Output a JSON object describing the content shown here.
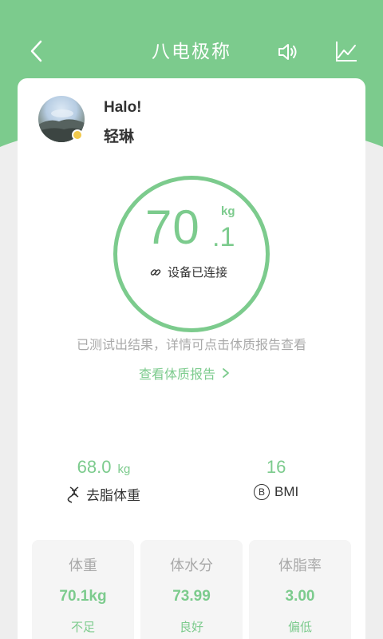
{
  "header": {
    "title": "八电极称",
    "back_icon": "chevron-left-icon",
    "sound_icon": "speaker-icon",
    "chart_icon": "trend-chart-icon"
  },
  "profile": {
    "greeting": "Halo!",
    "name": "轻琳"
  },
  "measurement": {
    "integer": "70",
    "decimal": ".1",
    "unit": "kg",
    "device_status": "设备已连接"
  },
  "hint": "已测试出结果，详情可点击体质报告查看",
  "report_link": "查看体质报告",
  "stats": {
    "lean_mass": {
      "value": "68.0",
      "unit": "kg",
      "label": "去脂体重"
    },
    "bmi": {
      "value": "16",
      "badge": "B",
      "label": "BMI"
    }
  },
  "metrics": [
    {
      "name": "体重",
      "value": "70.1kg",
      "status": "不足"
    },
    {
      "name": "体水分",
      "value": "73.99",
      "status": "良好"
    },
    {
      "name": "体脂率",
      "value": "3.00",
      "status": "偏低"
    }
  ],
  "colors": {
    "accent": "#7ccb8d",
    "background": "#eeeeee",
    "card": "#ffffff",
    "text": "#333333",
    "muted": "#a9a9a9"
  }
}
